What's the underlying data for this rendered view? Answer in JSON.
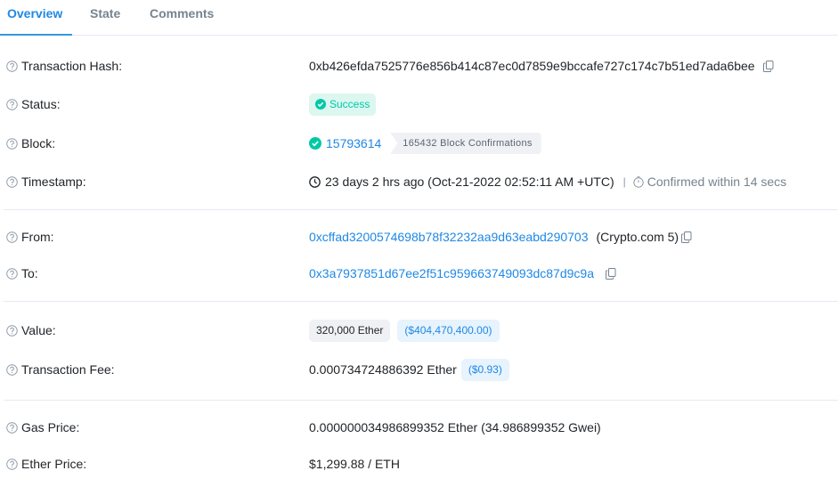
{
  "tabs": [
    {
      "label": "Overview",
      "active": true
    },
    {
      "label": "State",
      "active": false
    },
    {
      "label": "Comments",
      "active": false
    }
  ],
  "rows": {
    "tx_hash": {
      "label": "Transaction Hash:",
      "value": "0xb426efda7525776e856b414c87ec0d7859e9bccafe727c174c7b51ed7ada6bee"
    },
    "status": {
      "label": "Status:",
      "value": "Success"
    },
    "block": {
      "label": "Block:",
      "value": "15793614",
      "confirmations": "165432 Block Confirmations"
    },
    "timestamp": {
      "label": "Timestamp:",
      "value": "23 days 2 hrs ago (Oct-21-2022 02:52:11 AM +UTC)",
      "separator": "|",
      "confirmed": "Confirmed within 14 secs"
    },
    "from": {
      "label": "From:",
      "address": "0xcffad3200574698b78f32232aa9d63eabd290703",
      "name_tag": "(Crypto.com 5)"
    },
    "to": {
      "label": "To:",
      "address": "0x3a7937851d67ee2f51c959663749093dc87d9c9a"
    },
    "value": {
      "label": "Value:",
      "amount": "320,000 Ether",
      "usd": "($404,470,400.00)"
    },
    "fee": {
      "label": "Transaction Fee:",
      "amount": "0.000734724886392 Ether",
      "usd": "($0.93)"
    },
    "gas_price": {
      "label": "Gas Price:",
      "value": "0.000000034986899352 Ether (34.986899352 Gwei)"
    },
    "ether_price": {
      "label": "Ether Price:",
      "value": "$1,299.88 / ETH"
    }
  },
  "colors": {
    "accent": "#1e88e5",
    "success": "#00c9a7",
    "success_bg": "#dcf7f0",
    "divider": "#e7eaf3"
  }
}
